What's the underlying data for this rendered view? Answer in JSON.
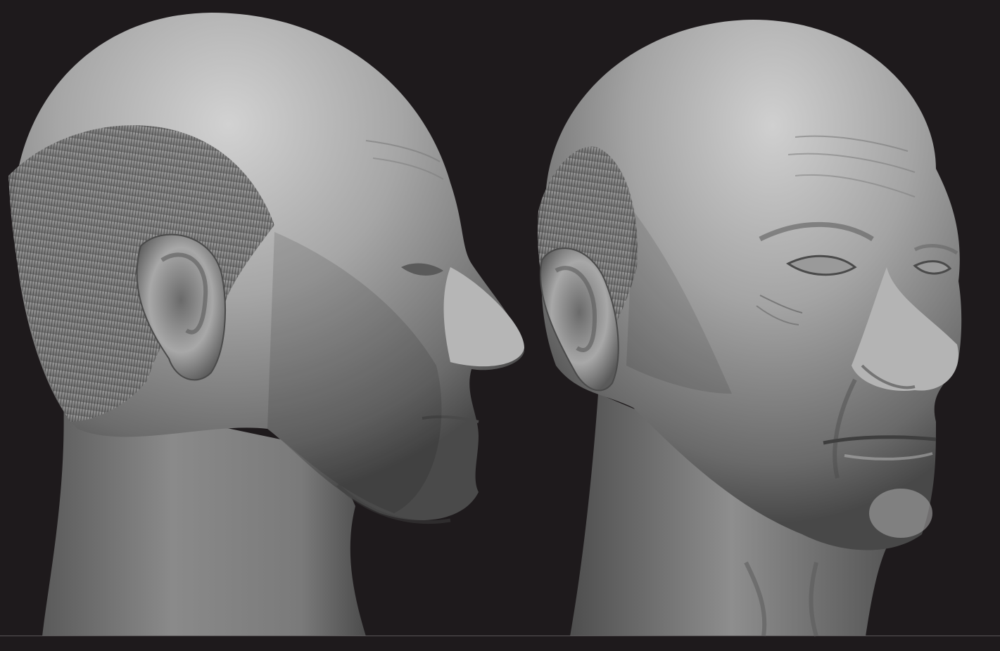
{
  "scene": {
    "background_color": "#1e1a1c",
    "clay_color": "#8c8c8c",
    "clay_highlight": "#c4c4c4",
    "clay_shadow": "#3e3e3e",
    "floor_line_color": "#5a5658",
    "models": [
      {
        "view": "profile-right"
      },
      {
        "view": "three-quarter-right"
      }
    ]
  }
}
